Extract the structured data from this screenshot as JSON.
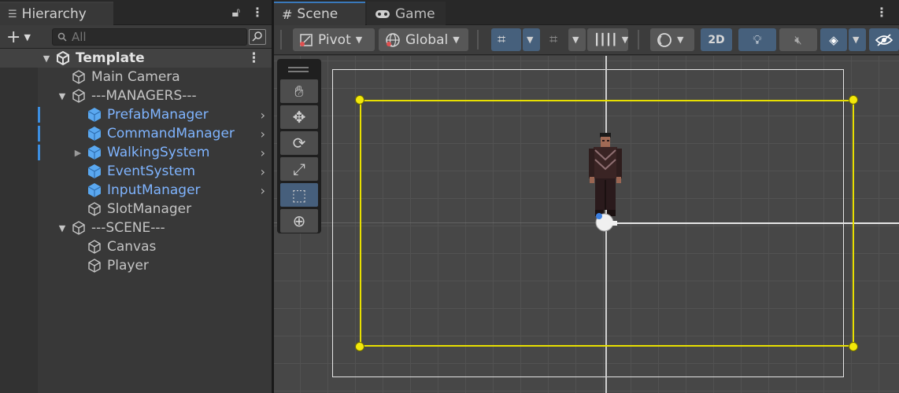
{
  "hierarchy": {
    "tab_label": "Hierarchy",
    "search_placeholder": "All",
    "scene_name": "Template",
    "items": [
      {
        "label": "Main Camera"
      },
      {
        "label": "---MANAGERS---"
      },
      {
        "label": "PrefabManager"
      },
      {
        "label": "CommandManager"
      },
      {
        "label": "WalkingSystem"
      },
      {
        "label": "EventSystem"
      },
      {
        "label": "InputManager"
      },
      {
        "label": "SlotManager"
      },
      {
        "label": "---SCENE---"
      },
      {
        "label": "Canvas"
      },
      {
        "label": "Player"
      }
    ]
  },
  "scene": {
    "tabs": [
      {
        "label": "Scene",
        "icon": "grid-icon"
      },
      {
        "label": "Game",
        "icon": "gamepad-icon"
      }
    ],
    "toolbar": {
      "pivot_label": "Pivot",
      "global_label": "Global",
      "mode_2d_label": "2D"
    }
  },
  "colors": {
    "accent_blue": "#3a79bb",
    "prefab_text": "#7fb4ff",
    "selection_yellow": "#e8e000"
  }
}
